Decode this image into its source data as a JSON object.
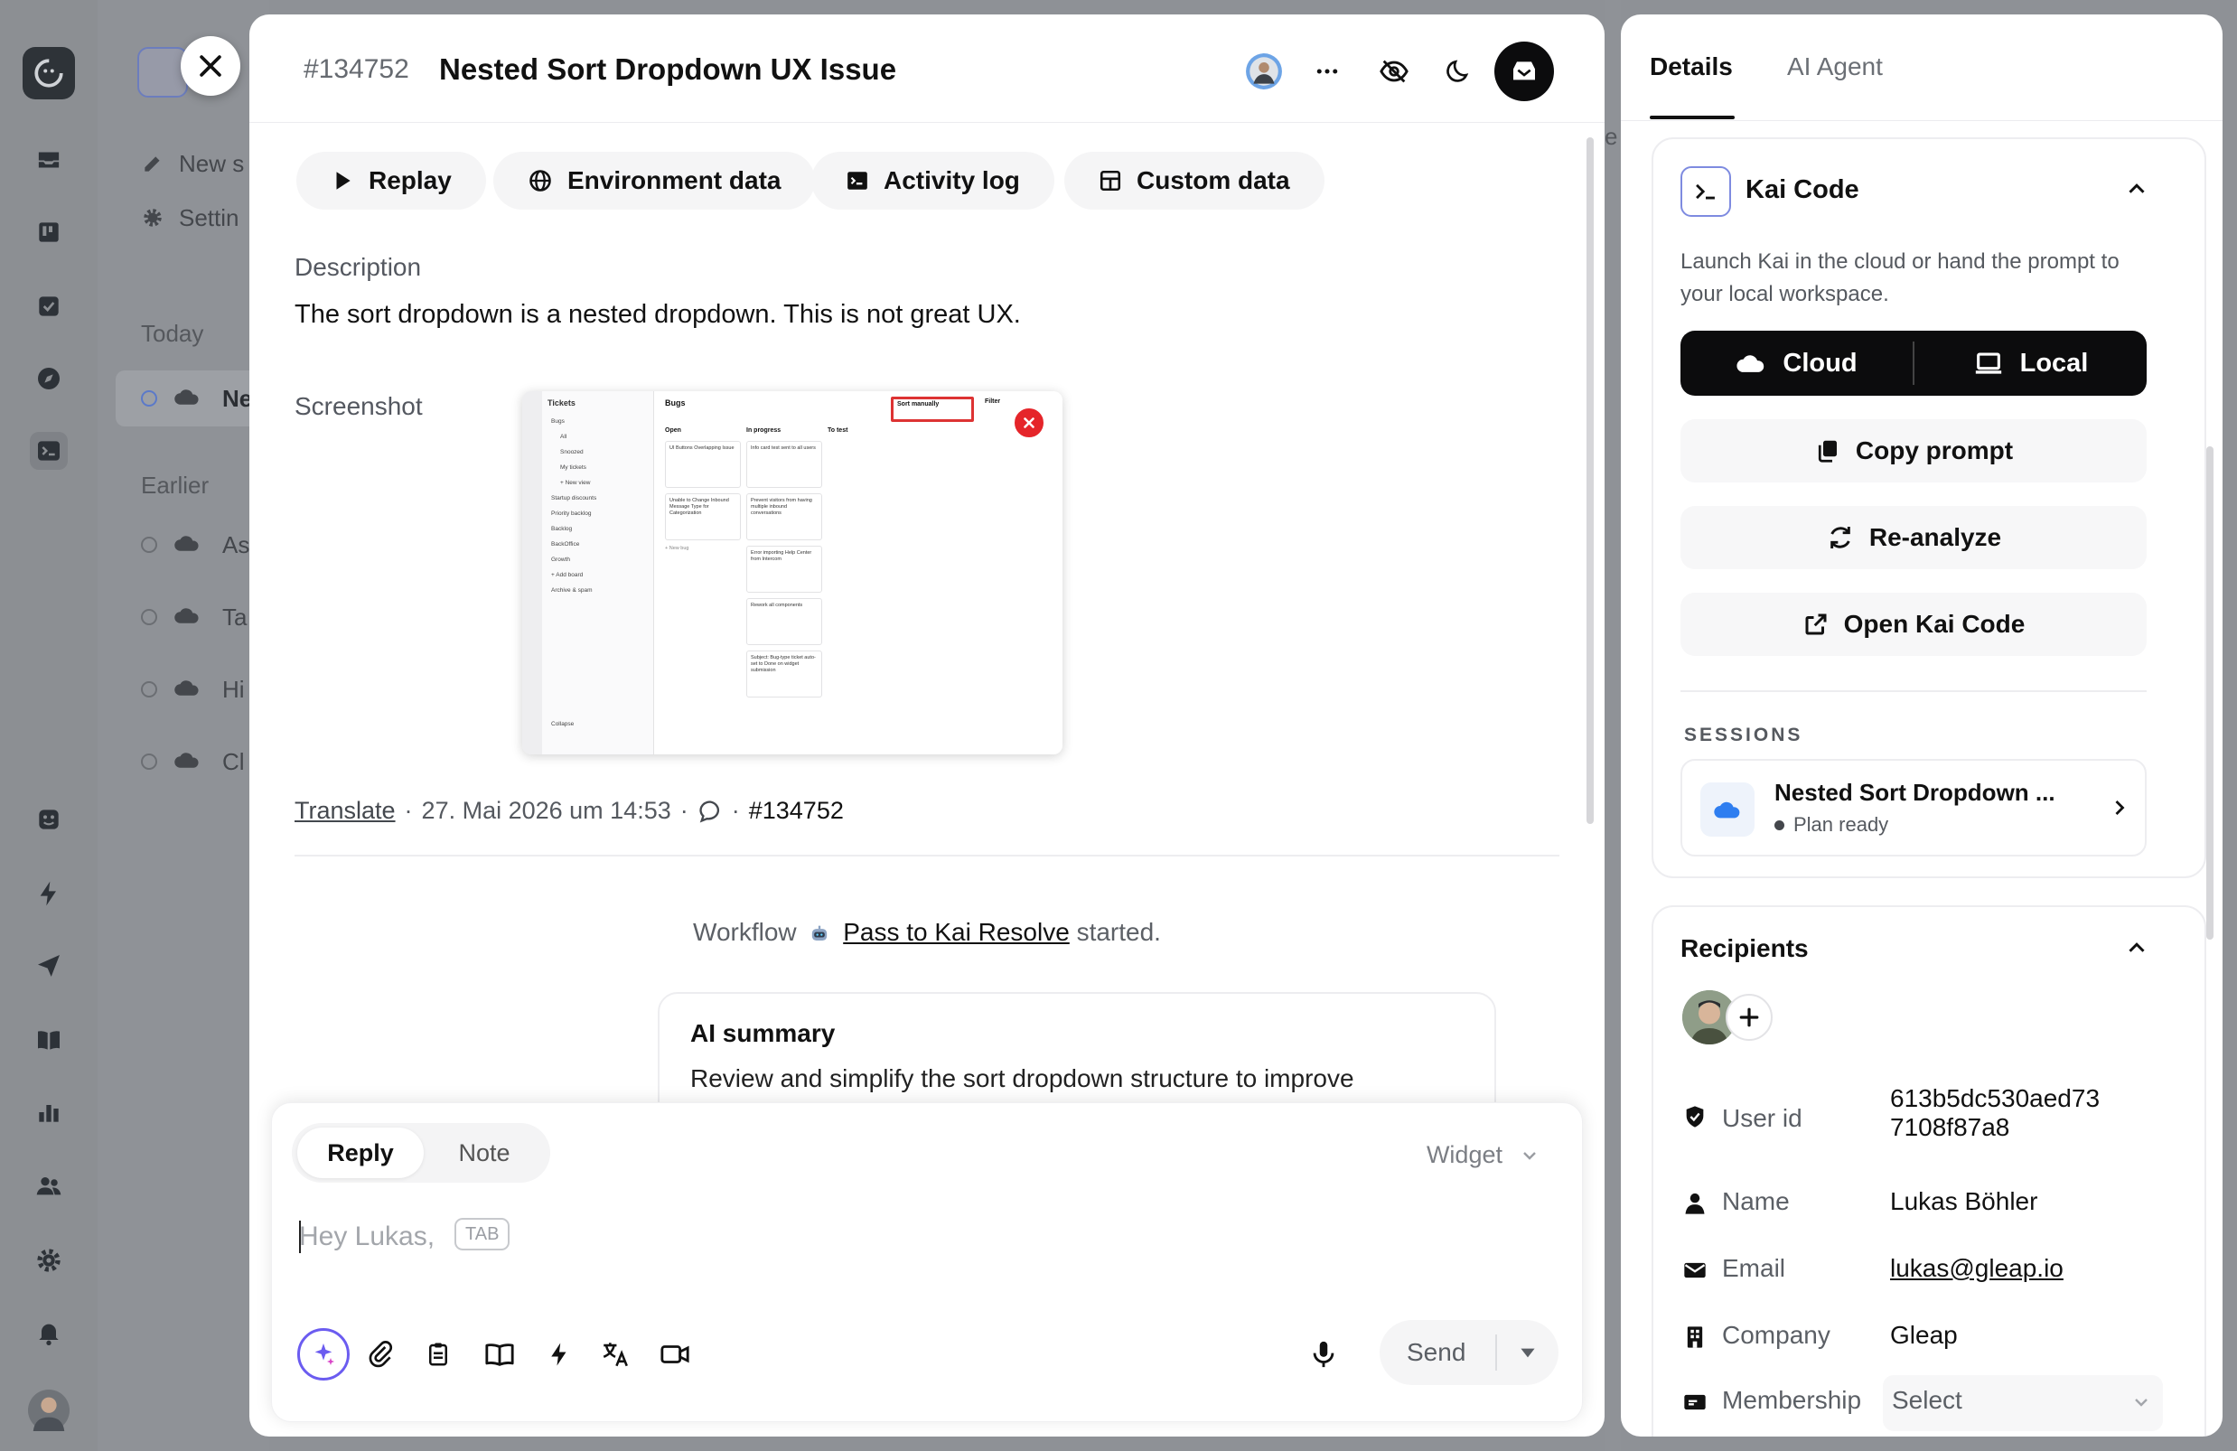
{
  "colors": {
    "accent": "#1a1a1a",
    "danger": "#e5252a",
    "cloud_blue": "#2f7ef0"
  },
  "background": {
    "sidebar_items": [
      {
        "label": "New s"
      },
      {
        "label": "Settin"
      }
    ],
    "today_label": "Today",
    "today_items": [
      {
        "label": "Ne"
      }
    ],
    "earlier_label": "Earlier",
    "earlier_items": [
      {
        "label": "As"
      },
      {
        "label": "Ta"
      },
      {
        "label": "Hi"
      },
      {
        "label": "Cl"
      }
    ],
    "right_peek": "e"
  },
  "ticket": {
    "id": "#134752",
    "title": "Nested Sort Dropdown UX Issue"
  },
  "tabs": [
    {
      "label": "Replay"
    },
    {
      "label": "Environment data"
    },
    {
      "label": "Activity log"
    },
    {
      "label": "Custom data"
    }
  ],
  "description": {
    "label": "Description",
    "text": "The sort dropdown is a nested dropdown. This is not great UX."
  },
  "screenshot": {
    "label": "Screenshot",
    "sidebar_title": "Tickets",
    "sidebar_items": [
      "Bugs",
      "All",
      "Snoozed",
      "My tickets",
      "+ New view",
      "Startup discounts",
      "Priority backlog",
      "Backlog",
      "BackOffice",
      "Growth",
      "+ Add board",
      "Archive & spam",
      "Collapse"
    ],
    "board_title": "Bugs",
    "sort_label": "Sort manually",
    "filter_label": "Filter",
    "columns": [
      {
        "name": "Open",
        "cards": [
          "UI Buttons Overlapping Issue",
          "Unable to Change Inbound Message Type for Categorization"
        ]
      },
      {
        "name": "In progress",
        "cards": [
          "Info card test sent to all users",
          "Prevent visitors from having multiple inbound conversations",
          "Error importing Help Center from Intercom",
          "Rework all components",
          "Subject: Bug-type ticket auto-set to Done on widget submission"
        ]
      },
      {
        "name": "To test",
        "cards": []
      }
    ],
    "new_bug": "+ New bug"
  },
  "meta": {
    "translate": "Translate",
    "separator": "·",
    "date": "27. Mai 2026 um 14:53",
    "ticket_ref": "#134752"
  },
  "workflow": {
    "prefix": "Workflow",
    "link": "Pass to Kai Resolve",
    "suffix": "started."
  },
  "ai_summary": {
    "title": "AI summary",
    "text": "Review and simplify the sort dropdown structure to improve"
  },
  "composer": {
    "tabs": [
      {
        "label": "Reply"
      },
      {
        "label": "Note"
      }
    ],
    "channel": "Widget",
    "placeholder": "Hey Lukas,",
    "tab_hint": "TAB",
    "send_label": "Send"
  },
  "side_panel": {
    "tabs": [
      {
        "label": "Details"
      },
      {
        "label": "AI Agent"
      }
    ],
    "kai": {
      "title": "Kai Code",
      "description": "Launch Kai in the cloud or hand the prompt to your local workspace.",
      "cloud_label": "Cloud",
      "local_label": "Local",
      "copy_prompt": "Copy prompt",
      "reanalyze": "Re-analyze",
      "open_kai": "Open Kai Code",
      "sessions_label": "SESSIONS",
      "session": {
        "title": "Nested Sort Dropdown ...",
        "status": "Plan ready"
      }
    },
    "recipients": {
      "title": "Recipients",
      "fields": [
        {
          "label": "User id",
          "value": "613b5dc530aed73\n7108f87a8"
        },
        {
          "label": "Name",
          "value": "Lukas Böhler"
        },
        {
          "label": "Email",
          "value": "lukas@gleap.io"
        },
        {
          "label": "Company",
          "value": "Gleap"
        },
        {
          "label": "Membership",
          "value": "Select"
        }
      ]
    }
  }
}
